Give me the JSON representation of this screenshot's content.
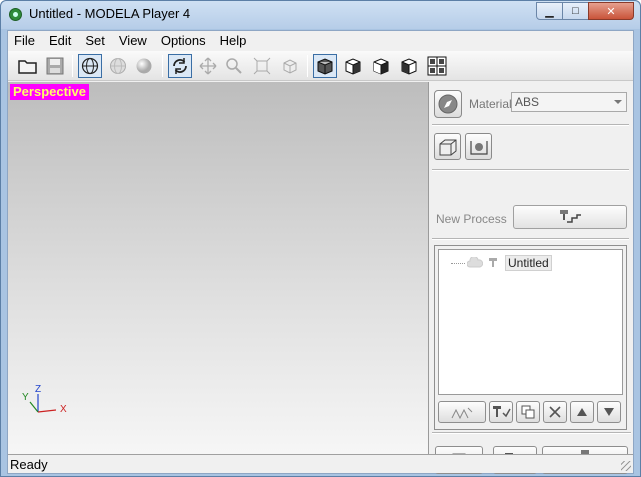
{
  "window": {
    "title": "Untitled - MODELA Player 4",
    "minimize": "▁",
    "maximize": "□",
    "close": "✕"
  },
  "menu": [
    "File",
    "Edit",
    "Set",
    "View",
    "Options",
    "Help"
  ],
  "toolbar": {
    "items": [
      "open-icon",
      "save-icon",
      "wireframe-view-icon",
      "surface-view-icon",
      "shaded-view-icon",
      "rotate-icon",
      "pan-icon",
      "zoom-icon",
      "fit-icon",
      "zoom-box-icon",
      "view-iso-icon",
      "view-front-icon",
      "view-right-icon",
      "view-left-icon",
      "view-four-pane-icon"
    ]
  },
  "viewport": {
    "label": "Perspective",
    "axes": {
      "x": "X",
      "y": "Y",
      "z": "Z"
    }
  },
  "panel": {
    "material_label": "Material",
    "material_value": "ABS",
    "new_process_label": "New Process",
    "tree": {
      "root_label": "Untitled"
    }
  },
  "colors": {
    "perspective_bg": "#ff00ff",
    "perspective_fg": "#ffff66"
  },
  "status": {
    "text": "Ready"
  }
}
